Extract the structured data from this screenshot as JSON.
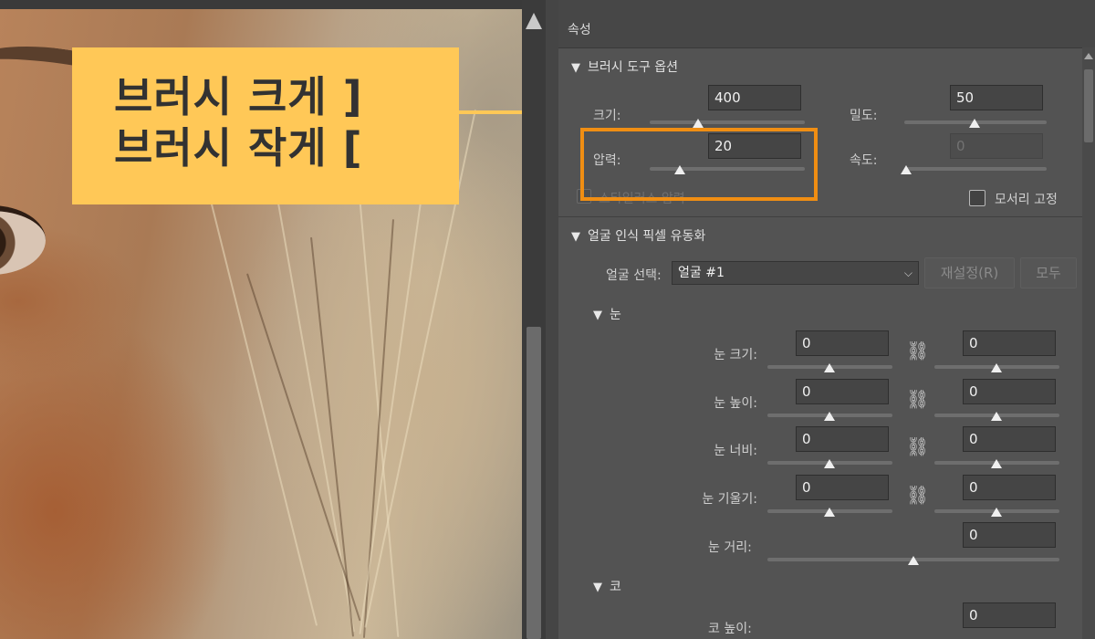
{
  "callout": {
    "line1": "브러시 크게  ]",
    "line2": "브러시 작게  [",
    "bg_color": "#ffc857"
  },
  "panel": {
    "title": "속성",
    "brush_section": {
      "title": "브러시 도구 옵션",
      "size": {
        "label": "크기:",
        "value": "400",
        "level": 0.37
      },
      "density": {
        "label": "밀도:",
        "value": "50",
        "level": 0.5
      },
      "pressure": {
        "label": "압력:",
        "value": "20",
        "level": 0.2
      },
      "rate": {
        "label": "속도:",
        "value": "0",
        "level": 0.0
      },
      "stylus_pressure": {
        "label": "스타일러스 압력",
        "checked": false,
        "enabled": false
      },
      "pin_edges": {
        "label": "모서리 고정",
        "checked": false
      }
    },
    "face_section": {
      "title": "얼굴 인식 픽셀 유동화",
      "select_face_label": "얼굴 선택:",
      "select_face_value": "얼굴 #1",
      "reset_button": "재설정(R)",
      "all_button": "모두",
      "eyes": {
        "title": "눈",
        "rows": [
          {
            "label": "눈 크기:",
            "left": "0",
            "right": "0",
            "linked": true
          },
          {
            "label": "눈 높이:",
            "left": "0",
            "right": "0",
            "linked": true
          },
          {
            "label": "눈 너비:",
            "left": "0",
            "right": "0",
            "linked": true
          },
          {
            "label": "눈 기울기:",
            "left": "0",
            "right": "0",
            "linked": true
          }
        ],
        "distance": {
          "label": "눈 거리:",
          "value": "0"
        }
      },
      "nose": {
        "title": "코",
        "height": {
          "label": "코 높이:",
          "value": "0"
        }
      }
    }
  },
  "colors": {
    "highlight": "#f08e13",
    "panel_bg": "#535353"
  },
  "icons": {
    "section_toggle": "triangle-down-icon",
    "link": "chain-link-icon",
    "dropdown": "chevron-down-icon"
  }
}
